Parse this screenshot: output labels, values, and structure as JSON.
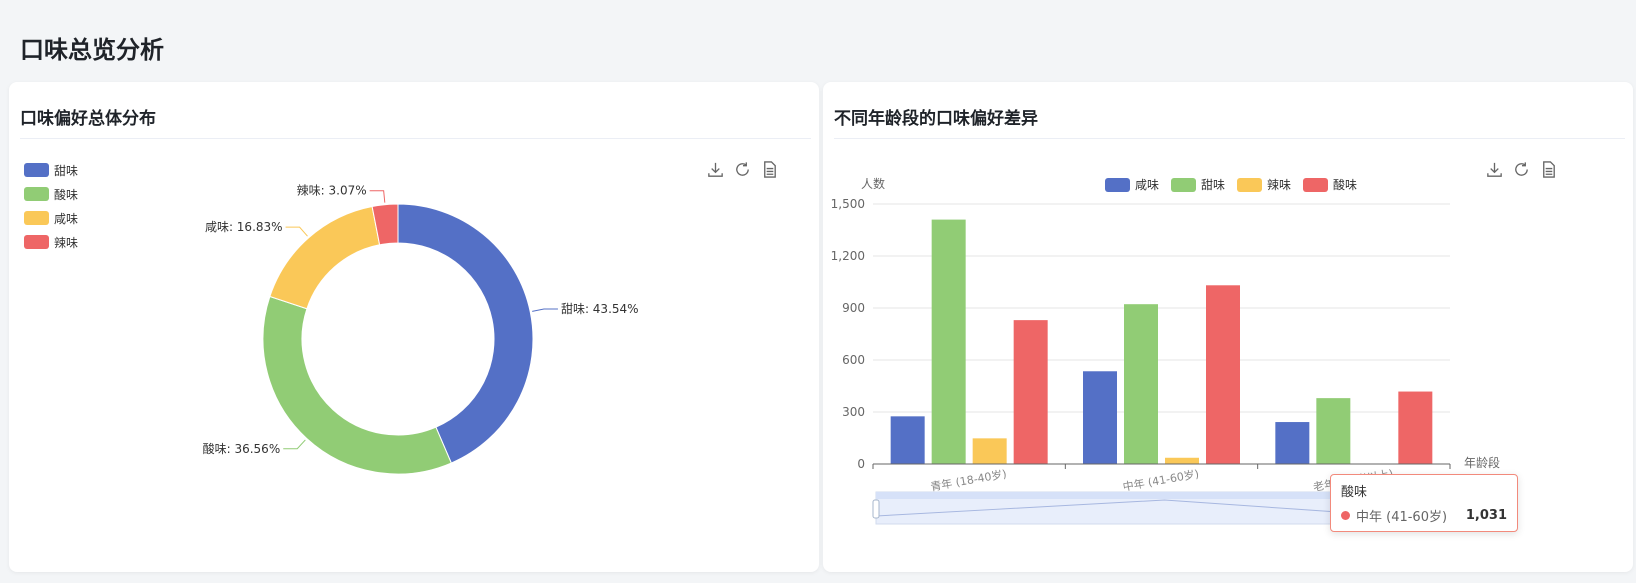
{
  "page_title": "口味总览分析",
  "toolbox": {
    "save": "save-as-image",
    "restore": "restore",
    "data": "data-view"
  },
  "colors": {
    "sweet": "#5470c6",
    "sour": "#91cc75",
    "salty": "#fac858",
    "spicy": "#ee6666"
  },
  "chart_data": [
    {
      "type": "pie",
      "title": "口味偏好总体分布",
      "donut": true,
      "legend_position": "top-left",
      "legend": [
        "甜味",
        "酸味",
        "咸味",
        "辣味"
      ],
      "slices": [
        {
          "name": "甜味",
          "percent": 43.54,
          "label": "甜味: 43.54%",
          "color": "#5470c6"
        },
        {
          "name": "酸味",
          "percent": 36.56,
          "label": "酸味: 36.56%",
          "color": "#91cc75"
        },
        {
          "name": "咸味",
          "percent": 16.83,
          "label": "咸味: 16.83%",
          "color": "#fac858"
        },
        {
          "name": "辣味",
          "percent": 3.07,
          "label": "辣味: 3.07%",
          "color": "#ee6666"
        }
      ]
    },
    {
      "type": "bar",
      "title": "不同年龄段的口味偏好差异",
      "xlabel": "年龄段",
      "ylabel": "人数",
      "ylim": [
        0,
        1500
      ],
      "yticks": [
        "0",
        "300",
        "600",
        "900",
        "1,200",
        "1,500"
      ],
      "grid": true,
      "legend_position": "top-center",
      "categories": [
        "青年 (18-40岁)",
        "中年 (41-60岁)",
        "老年 (60岁以上)"
      ],
      "series": [
        {
          "name": "咸味",
          "color": "#5470c6",
          "values": [
            275,
            535,
            242
          ]
        },
        {
          "name": "甜味",
          "color": "#91cc75",
          "values": [
            1410,
            922,
            380
          ]
        },
        {
          "name": "辣味",
          "color": "#fac858",
          "values": [
            148,
            36,
            0
          ]
        },
        {
          "name": "酸味",
          "color": "#ee6666",
          "values": [
            830,
            1031,
            418
          ]
        }
      ],
      "tooltip": {
        "title": "酸味",
        "category": "中年 (41-60岁)",
        "value": "1,031",
        "color": "#ee6666"
      },
      "data_zoom": {
        "start": 0,
        "end": 100
      }
    }
  ]
}
